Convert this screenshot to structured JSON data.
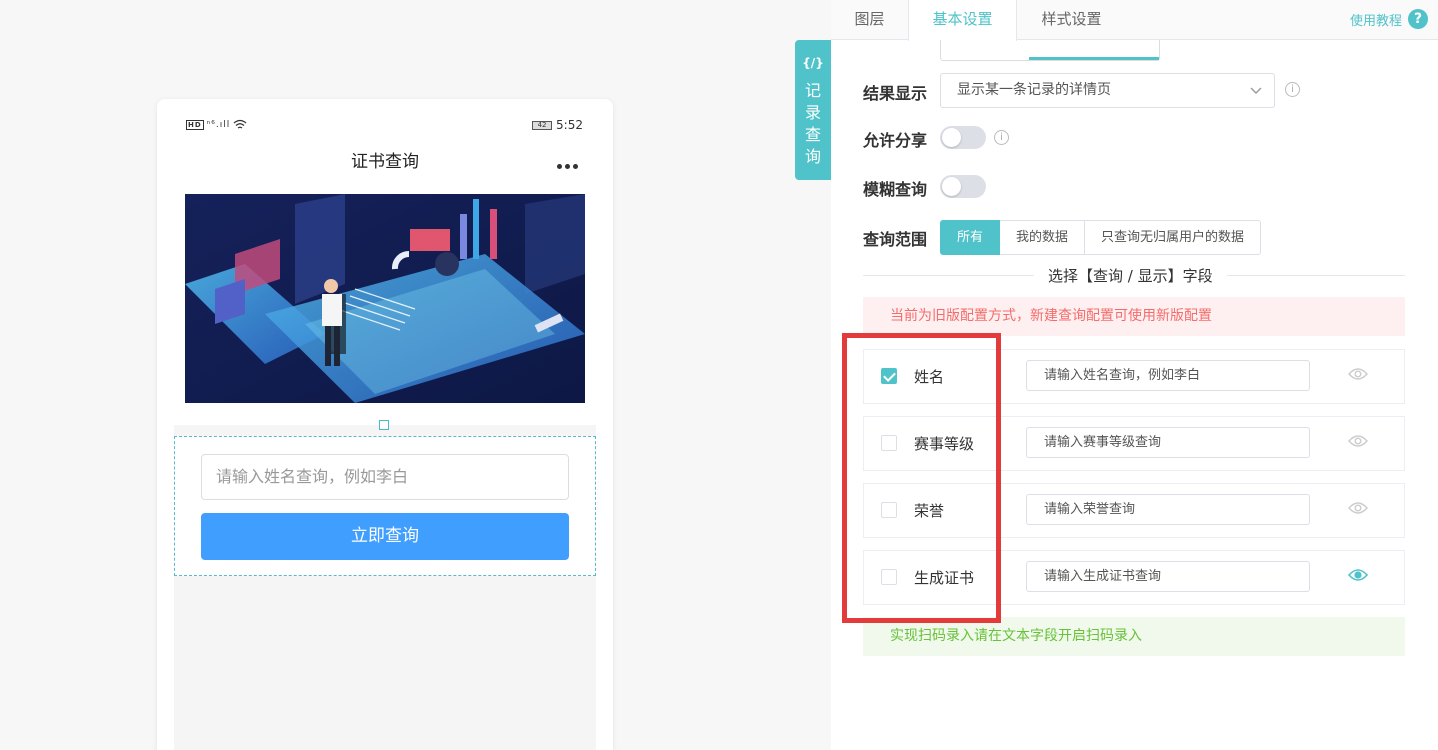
{
  "phone": {
    "status_icons": "ⁿ⁶.ıll",
    "hd": "HD",
    "battery": "42",
    "time": "5:52",
    "title": "证书查询",
    "input_placeholder": "请输入姓名查询，例如李白",
    "query_button": "立即查询"
  },
  "side_tab": {
    "code": "{/}",
    "label": "记录查询"
  },
  "tabs": [
    {
      "label": "图层"
    },
    {
      "label": "基本设置"
    },
    {
      "label": "样式设置"
    }
  ],
  "help": {
    "label": "使用教程",
    "icon": "?"
  },
  "settings": {
    "result_display": {
      "label": "结果显示",
      "value": "显示某一条记录的详情页"
    },
    "allow_share": {
      "label": "允许分享"
    },
    "fuzzy_query": {
      "label": "模糊查询"
    },
    "query_scope": {
      "label": "查询范围",
      "options": [
        "所有",
        "我的数据",
        "只查询无归属用户的数据"
      ],
      "selected": "所有"
    },
    "section_title": "选择【查询 / 显示】字段",
    "alert_old": "当前为旧版配置方式，新建查询配置可使用新版配置",
    "fields": [
      {
        "name": "姓名",
        "checked": true,
        "placeholder": "请输入姓名查询，例如李白",
        "visible": false
      },
      {
        "name": "赛事等级",
        "checked": false,
        "placeholder": "请输入赛事等级查询",
        "visible": false
      },
      {
        "name": "荣誉",
        "checked": false,
        "placeholder": "请输入荣誉查询",
        "visible": false
      },
      {
        "name": "生成证书",
        "checked": false,
        "placeholder": "请输入生成证书查询",
        "visible": true
      }
    ],
    "alert_scan": "实现扫码录入请在文本字段开启扫码录入"
  },
  "colors": {
    "accent": "#4fc3c9",
    "button_blue": "#409eff",
    "highlight_red": "#e33b3b",
    "eye_inactive": "#cccccc"
  }
}
